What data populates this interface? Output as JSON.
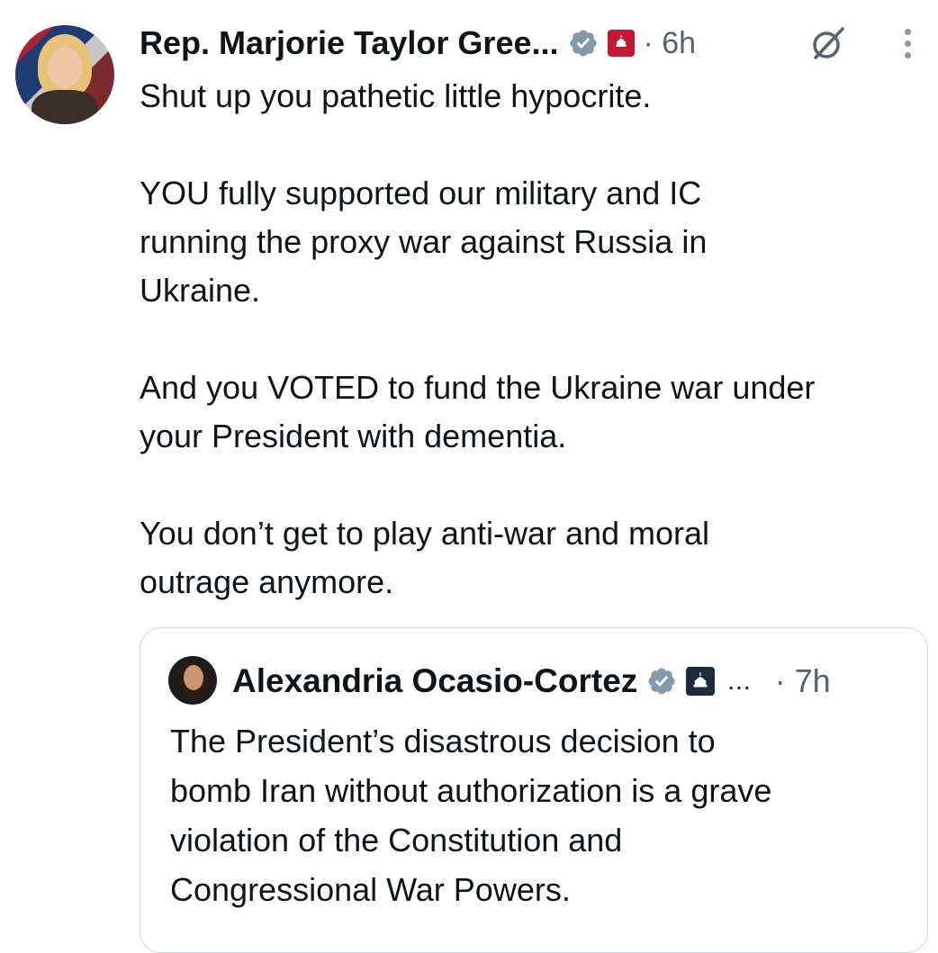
{
  "tweet": {
    "author": "Rep. Marjorie Taylor Gree...",
    "dot_time": "· 6h",
    "verified_icon": "verified-badge-icon",
    "affiliation_icon": "us-capitol-icon",
    "paragraphs": [
      [
        "Shut up you pathetic little hypocrite."
      ],
      [
        "YOU fully supported our military and IC",
        "running the proxy war against Russia in",
        "Ukraine."
      ],
      [
        "And you VOTED to fund the Ukraine war under",
        "your President with dementia."
      ],
      [
        "You don’t get to play anti-war and moral",
        "outrage anymore."
      ]
    ]
  },
  "quote": {
    "author": "Alexandria Ocasio-Cortez",
    "ellipsis": "...",
    "dot_time": "· 7h",
    "lines": [
      "The President’s disastrous decision to",
      "bomb Iran without authorization is a grave",
      "violation of the Constitution and",
      "Congressional War Powers."
    ]
  },
  "colors": {
    "text": "#0f1419",
    "secondary": "#536471",
    "verified_badge": "#829aab",
    "border": "#cfd9de",
    "affil_red": "#c7182f"
  }
}
